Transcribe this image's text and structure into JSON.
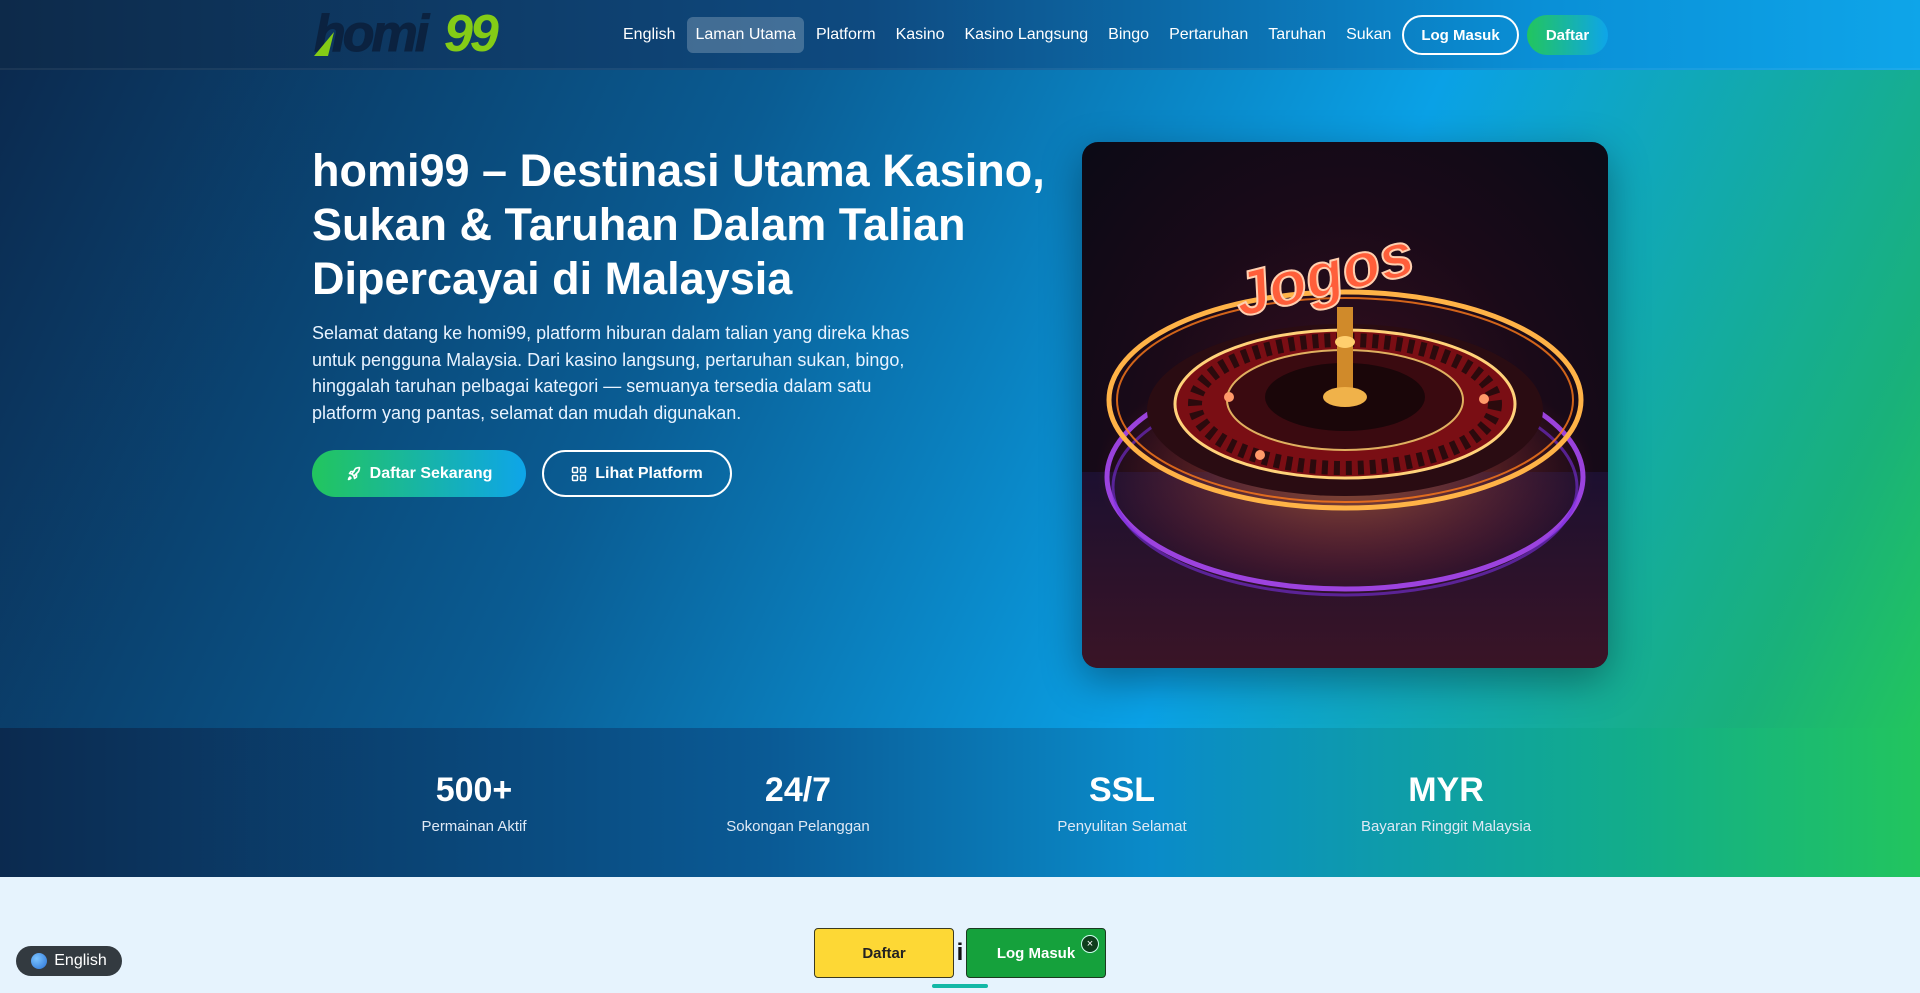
{
  "header": {
    "logo_text": "homi99",
    "nav": [
      {
        "label": "English",
        "active": false
      },
      {
        "label": "Laman Utama",
        "active": true
      },
      {
        "label": "Platform",
        "active": false
      },
      {
        "label": "Kasino",
        "active": false
      },
      {
        "label": "Kasino Langsung",
        "active": false
      },
      {
        "label": "Bingo",
        "active": false
      },
      {
        "label": "Pertaruhan",
        "active": false
      },
      {
        "label": "Taruhan",
        "active": false
      },
      {
        "label": "Sukan",
        "active": false
      }
    ],
    "login_label": "Log Masuk",
    "register_label": "Daftar"
  },
  "hero": {
    "title": "homi99 – Destinasi Utama Kasino, Sukan & Taruhan Dalam Talian Dipercayai di Malaysia",
    "description": "Selamat datang ke homi99, platform hiburan dalam talian yang direka khas untuk pengguna Malaysia. Dari kasino langsung, pertaruhan sukan, bingo, hinggalah taruhan pelbagai kategori — semuanya tersedia dalam satu platform yang pantas, selamat dan mudah digunakan.",
    "primary_button": "Daftar Sekarang",
    "secondary_button": "Lihat Platform",
    "image_sign_text": "Jogos"
  },
  "stats": [
    {
      "value": "500+",
      "label": "Permainan Aktif"
    },
    {
      "value": "24/7",
      "label": "Sokongan Pelanggan"
    },
    {
      "value": "SSL",
      "label": "Penyulitan Selamat"
    },
    {
      "value": "MYR",
      "label": "Bayaran Ringgit Malaysia"
    }
  ],
  "floating_bar": {
    "register_label": "Daftar",
    "login_label": "Log Masuk",
    "between_glyph": "i",
    "close_icon": "×"
  },
  "language_pill": {
    "label": "English"
  },
  "colors": {
    "accent_green": "#22c55e",
    "accent_blue": "#0ea5e9",
    "floating_yellow": "#fdd835",
    "floating_green": "#15a13c"
  }
}
